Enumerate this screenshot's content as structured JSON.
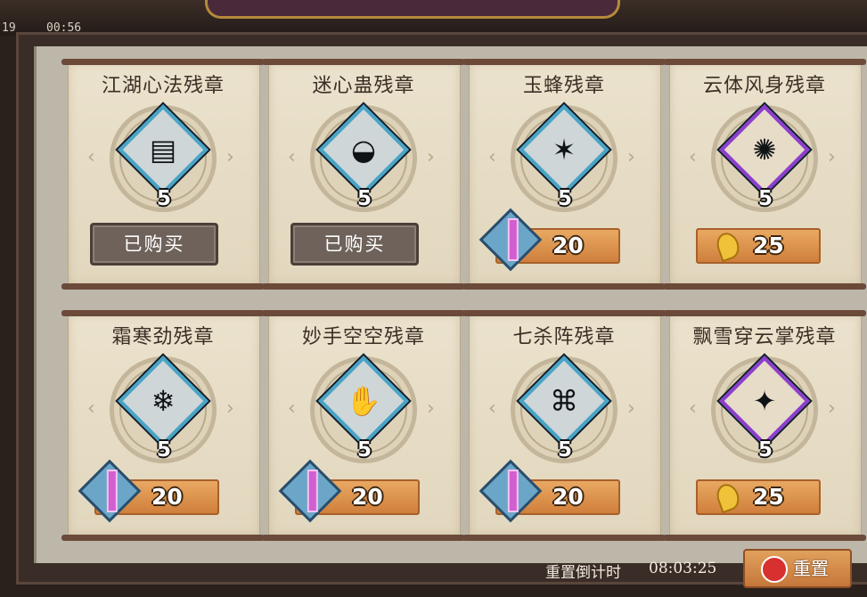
{
  "status": {
    "left_text": "19",
    "time_text": "00:56"
  },
  "cards": [
    {
      "title": "江湖心法残章",
      "count": "5",
      "frame": "blue",
      "icon": "manual-icon",
      "bought": "已购买",
      "price": "",
      "currency": ""
    },
    {
      "title": "迷心蛊残章",
      "count": "5",
      "frame": "blue",
      "icon": "gu-bowl-icon",
      "bought": "已购买",
      "price": "",
      "currency": ""
    },
    {
      "title": "玉蜂残章",
      "count": "5",
      "frame": "blue",
      "icon": "bee-icon",
      "bought": "",
      "price": "20",
      "currency": "gem"
    },
    {
      "title": "云体风身残章",
      "count": "5",
      "frame": "purple",
      "icon": "wind-body-icon",
      "bought": "",
      "price": "25",
      "currency": "gold-leaf"
    },
    {
      "title": "霜寒劲残章",
      "count": "5",
      "frame": "blue",
      "icon": "frost-icon",
      "bought": "",
      "price": "20",
      "currency": "gem"
    },
    {
      "title": "妙手空空残章",
      "count": "5",
      "frame": "blue",
      "icon": "thief-hand-icon",
      "bought": "",
      "price": "20",
      "currency": "gem"
    },
    {
      "title": "七杀阵残章",
      "count": "5",
      "frame": "blue",
      "icon": "formation-icon",
      "bought": "",
      "price": "20",
      "currency": "gem"
    },
    {
      "title": "飘雪穿云掌残章",
      "count": "5",
      "frame": "purple",
      "icon": "palm-strike-icon",
      "bought": "",
      "price": "25",
      "currency": "gold-leaf"
    }
  ],
  "footer": {
    "reset_countdown_label": "重置倒计时",
    "reset_countdown_time": "08:03:25",
    "reset_button_label": "重置"
  }
}
